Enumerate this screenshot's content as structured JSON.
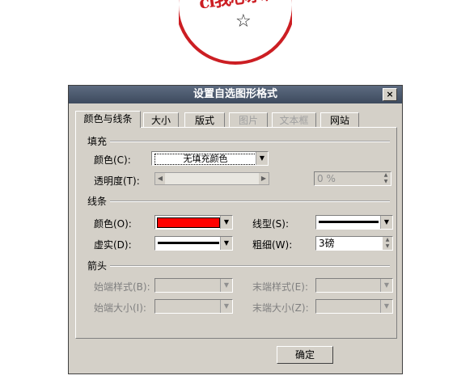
{
  "stamp": {
    "text": "cl我心永恒",
    "star": "☆",
    "color": "#cc1e23"
  },
  "dialog": {
    "title": "设置自选图形格式",
    "close": "×",
    "tabs": [
      {
        "label": "颜色与线条",
        "state": "active"
      },
      {
        "label": "大小",
        "state": "normal"
      },
      {
        "label": "版式",
        "state": "normal"
      },
      {
        "label": "图片",
        "state": "disabled"
      },
      {
        "label": "文本框",
        "state": "disabled"
      },
      {
        "label": "网站",
        "state": "normal"
      }
    ],
    "fill": {
      "heading": "填充",
      "color_label": "颜色(C):",
      "color_value": "无填充颜色",
      "transparency_label": "透明度(T):",
      "transparency_value": "0 %"
    },
    "line": {
      "heading": "线条",
      "color_label": "颜色(O):",
      "color_value": "#ff0000",
      "dash_label": "虚实(D):",
      "style_label": "线型(S):",
      "weight_label": "粗细(W):",
      "weight_value": "3磅"
    },
    "arrows": {
      "heading": "箭头",
      "begin_style_label": "始端样式(B):",
      "begin_size_label": "始端大小(I):",
      "end_style_label": "末端样式(E):",
      "end_size_label": "末端大小(Z):"
    },
    "ok": "确定"
  }
}
